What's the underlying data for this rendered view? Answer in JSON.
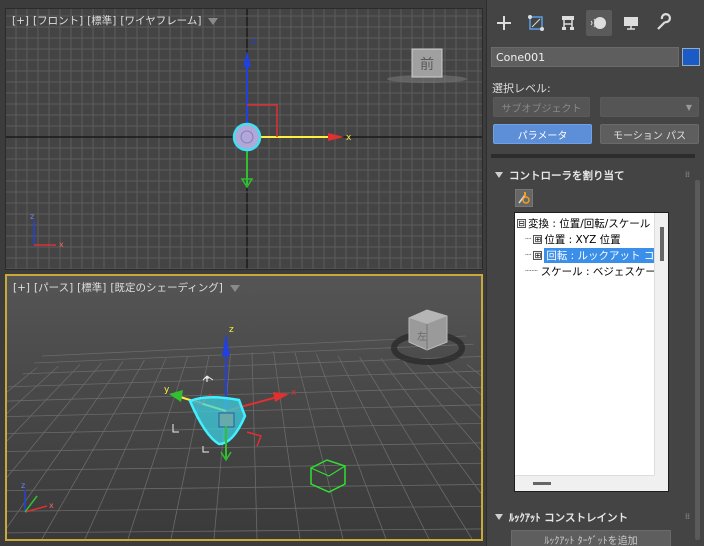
{
  "viewports": {
    "front": {
      "label_plus": "[+]",
      "label_view": "[フロント]",
      "label_mode": "[標準]",
      "label_shading": "[ワイヤフレーム]",
      "viewcube_text": "前"
    },
    "persp": {
      "label_plus": "[+]",
      "label_view": "[パース]",
      "label_mode": "[標準]",
      "label_shading": "[既定のシェーディング]",
      "viewcube_text": "左"
    }
  },
  "axis_labels": {
    "x": "x",
    "y": "y",
    "z": "z"
  },
  "command_panel": {
    "tabs": [
      "create-icon",
      "modify-icon",
      "hierarchy-icon",
      "motion-icon",
      "display-icon",
      "utilities-icon"
    ],
    "active_tab": 3,
    "object_name": "Cone001",
    "object_color": "#1b5bc6",
    "selection_level_label": "選択レベル:",
    "subobject_button": "サブオブジェクト",
    "subobject_dropdown": "",
    "parameters_button": "パラメータ",
    "motion_paths_button": "モーション パス",
    "assign_controller_title": "コントローラを割り当て",
    "tree": [
      {
        "sign": "⊟",
        "text": "変換 : 位置/回転/スケール"
      },
      {
        "sign": "⊞",
        "text": "位置 : XYZ 位置"
      },
      {
        "sign": "⊞",
        "text": "回転 : ルックアット コンストレイント"
      },
      {
        "sign": "",
        "text": "スケール : ベジェスケール"
      }
    ],
    "lookat_title": "ﾙｯｸｱｯﾄ コンストレイント",
    "lookat_add_button": "ﾙｯｸｱｯﾄ ﾀｰｹﾞｯﾄを追加"
  },
  "colors": {
    "x_axis": "#e03030",
    "y_axis": "#30c030",
    "z_axis": "#2040e0",
    "selected": "#40e0f0",
    "active_border": "#c9a93a"
  }
}
